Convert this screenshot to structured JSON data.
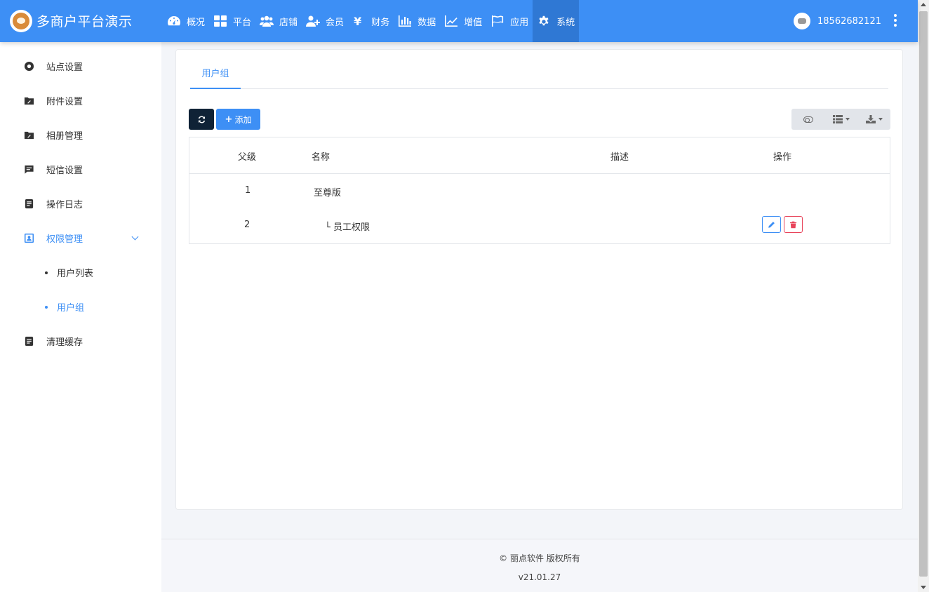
{
  "header": {
    "brand": "多商户平台演示",
    "nav": [
      {
        "label": "概况",
        "icon": "dashboard-icon"
      },
      {
        "label": "平台",
        "icon": "grid-icon"
      },
      {
        "label": "店铺",
        "icon": "users-icon"
      },
      {
        "label": "会员",
        "icon": "user-plus-icon"
      },
      {
        "label": "财务",
        "icon": "yen-icon"
      },
      {
        "label": "数据",
        "icon": "bar-chart-icon"
      },
      {
        "label": "增值",
        "icon": "line-chart-icon"
      },
      {
        "label": "应用",
        "icon": "flag-icon"
      },
      {
        "label": "系统",
        "icon": "gear-icon"
      }
    ],
    "active_nav": "系统",
    "user_phone": "18562682121"
  },
  "sidebar": {
    "items": [
      {
        "label": "站点设置",
        "icon": "settings-circle-icon"
      },
      {
        "label": "附件设置",
        "icon": "folder-clip-icon"
      },
      {
        "label": "相册管理",
        "icon": "folder-clip-icon"
      },
      {
        "label": "短信设置",
        "icon": "message-icon"
      },
      {
        "label": "操作日志",
        "icon": "document-icon"
      },
      {
        "label": "权限管理",
        "icon": "user-badge-icon"
      },
      {
        "label": "清理缓存",
        "icon": "document-icon"
      }
    ],
    "submenu": [
      {
        "label": "用户列表"
      },
      {
        "label": "用户组"
      }
    ],
    "active_sub": "用户组"
  },
  "main": {
    "tab": "用户组",
    "add_label": "添加",
    "table": {
      "headers": [
        "父级",
        "名称",
        "描述",
        "操作"
      ],
      "rows": [
        {
          "parent": "1",
          "name": "至尊版",
          "desc": ""
        },
        {
          "parent": "2",
          "name": "└ 员工权限",
          "desc": ""
        }
      ]
    }
  },
  "footer": {
    "copyright": "© 丽点软件 版权所有",
    "version": "v21.01.27"
  },
  "colors": {
    "primary": "#3d8ff5",
    "dark": "#0f2236",
    "danger": "#e8435a"
  }
}
